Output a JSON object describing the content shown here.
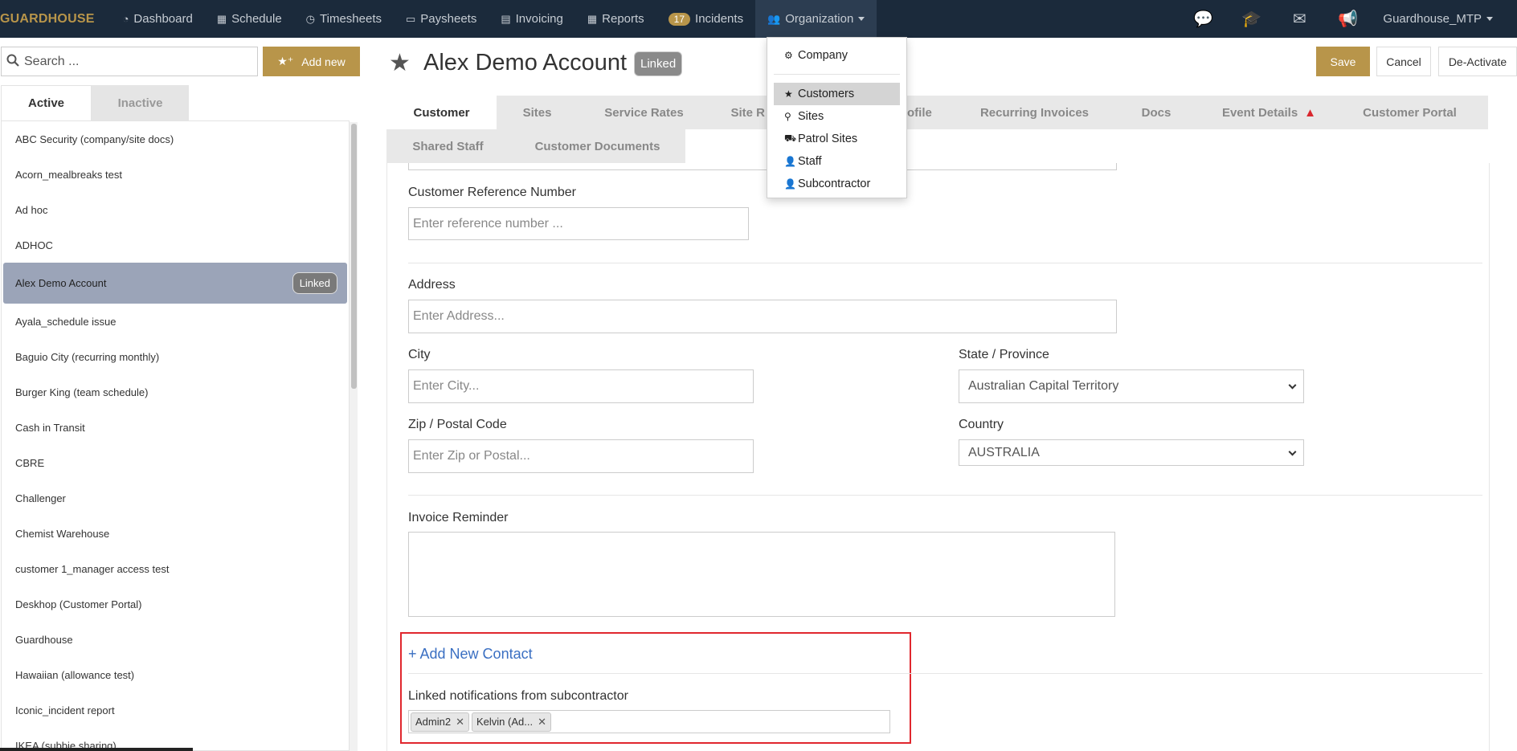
{
  "nav": {
    "brand": "GUARDHOUSE",
    "items": [
      {
        "label": "Dashboard",
        "icon": "dashboard-icon",
        "glyph": "◔"
      },
      {
        "label": "Schedule",
        "icon": "calendar-icon",
        "glyph": "▦"
      },
      {
        "label": "Timesheets",
        "icon": "clock-icon",
        "glyph": "◷"
      },
      {
        "label": "Paysheets",
        "icon": "money-icon",
        "glyph": "▭"
      },
      {
        "label": "Invoicing",
        "icon": "invoice-icon",
        "glyph": "▤"
      },
      {
        "label": "Reports",
        "icon": "table-icon",
        "glyph": "▦"
      }
    ],
    "incidents_badge": "17",
    "incidents_label": "Incidents",
    "organization_label": "Organization",
    "user": "Guardhouse_MTP",
    "right_icons": [
      "chat-icon",
      "graduation-cap-icon",
      "envelope-icon",
      "megaphone-icon"
    ]
  },
  "dropdown": {
    "top": {
      "label": "Company",
      "icon": "gear-icon",
      "glyph": "⚙"
    },
    "items": [
      {
        "label": "Customers",
        "icon": "star-icon",
        "glyph": "★",
        "selected": true
      },
      {
        "label": "Sites",
        "icon": "map-marker-icon",
        "glyph": "⚲"
      },
      {
        "label": "Patrol Sites",
        "icon": "car-icon",
        "glyph": "⛟"
      },
      {
        "label": "Staff",
        "icon": "user-icon",
        "glyph": "👤"
      },
      {
        "label": "Subcontractor",
        "icon": "user-icon",
        "glyph": "👤"
      }
    ]
  },
  "sidebar": {
    "search_placeholder": "Search ...",
    "add_new": "Add new",
    "tab_active": "Active",
    "tab_inactive": "Inactive",
    "items": [
      "ABC Security (company/site docs)",
      "Acorn_mealbreaks test",
      "Ad hoc",
      "ADHOC",
      "Alex Demo Account",
      "Ayala_schedule issue",
      "Baguio City (recurring monthly)",
      "Burger King (team schedule)",
      "Cash in Transit",
      "CBRE",
      "Challenger",
      "Chemist Warehouse",
      "customer 1_manager access test",
      "Deskhop (Customer Portal)",
      "Guardhouse",
      "Hawaiian (allowance test)",
      "Iconic_incident report",
      "IKEA (subbie sharing)"
    ],
    "selected_index": 4,
    "selected_badge": "Linked"
  },
  "header": {
    "title": "Alex Demo Account",
    "pill": "Linked",
    "save": "Save",
    "cancel": "Cancel",
    "deactivate": "De-Activate"
  },
  "tabs": {
    "row1": [
      "Customer",
      "Sites",
      "Service Rates",
      "Site R",
      "ofile",
      "Recurring Invoices",
      "Docs",
      "Event Details",
      "Customer Portal"
    ],
    "row2": [
      "Shared Staff",
      "Customer Documents"
    ]
  },
  "form": {
    "ref_label": "Customer Reference Number",
    "ref_placeholder": "Enter reference number ...",
    "address_label": "Address",
    "address_placeholder": "Enter Address...",
    "city_label": "City",
    "city_placeholder": "Enter City...",
    "state_label": "State / Province",
    "state_value": "Australian Capital Territory",
    "zip_label": "Zip / Postal Code",
    "zip_placeholder": "Enter Zip or Postal...",
    "country_label": "Country",
    "country_value": "AUSTRALIA",
    "invoice_label": "Invoice Reminder",
    "add_contact": "+ Add New Contact",
    "linked_label": "Linked notifications from subcontractor",
    "tags": [
      "Admin2",
      "Kelvin (Ad..."
    ]
  },
  "colors": {
    "nav_bg": "#1b2a3b",
    "accent_gold": "#b8954a",
    "selected_row": "#9ba4b8",
    "highlight_red": "#e0272e",
    "link_blue": "#3a6fc2"
  }
}
